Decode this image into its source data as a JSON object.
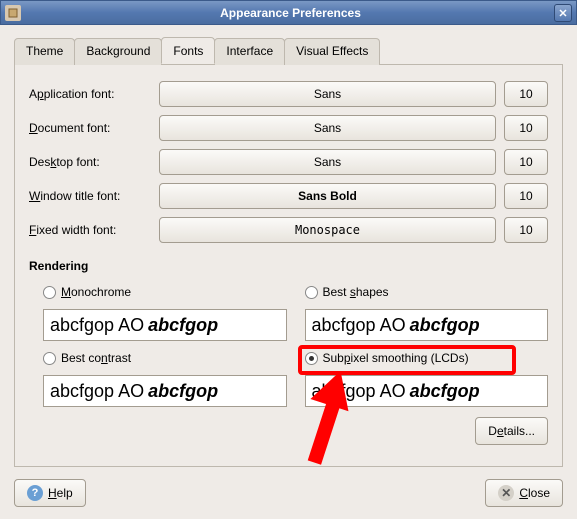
{
  "window": {
    "title": "Appearance Preferences"
  },
  "tabs": {
    "theme": "Theme",
    "background": "Background",
    "fonts": "Fonts",
    "interface": "Interface",
    "visual": "Visual Effects"
  },
  "fonts": {
    "app": {
      "label_pre": "A",
      "label_ul": "p",
      "label_post": "plication font:",
      "name": "Sans",
      "size": "10"
    },
    "doc": {
      "label_pre": "",
      "label_ul": "D",
      "label_post": "ocument font:",
      "name": "Sans",
      "size": "10"
    },
    "desk": {
      "label_pre": "Des",
      "label_ul": "k",
      "label_post": "top font:",
      "name": "Sans",
      "size": "10"
    },
    "title": {
      "label_pre": "",
      "label_ul": "W",
      "label_post": "indow title font:",
      "name": "Sans Bold",
      "size": "10"
    },
    "fixed": {
      "label_pre": "",
      "label_ul": "F",
      "label_post": "ixed width font:",
      "name": "Monospace",
      "size": "10"
    }
  },
  "rendering": {
    "heading": "Rendering",
    "mono": {
      "pre": "",
      "ul": "M",
      "post": "onochrome"
    },
    "shapes": {
      "pre": "Best ",
      "ul": "s",
      "post": "hapes"
    },
    "contrast": {
      "pre": "Best co",
      "ul": "n",
      "post": "trast"
    },
    "subpixel": {
      "pre": "Sub",
      "ul": "p",
      "post": "ixel smoothing (LCDs)"
    },
    "sample_plain": "abcfgop AO ",
    "sample_italic": "abcfgop"
  },
  "buttons": {
    "details": {
      "pre": "D",
      "ul": "e",
      "post": "tails..."
    },
    "help": {
      "ul": "H",
      "post": "elp"
    },
    "close": {
      "ul": "C",
      "post": "lose"
    }
  }
}
